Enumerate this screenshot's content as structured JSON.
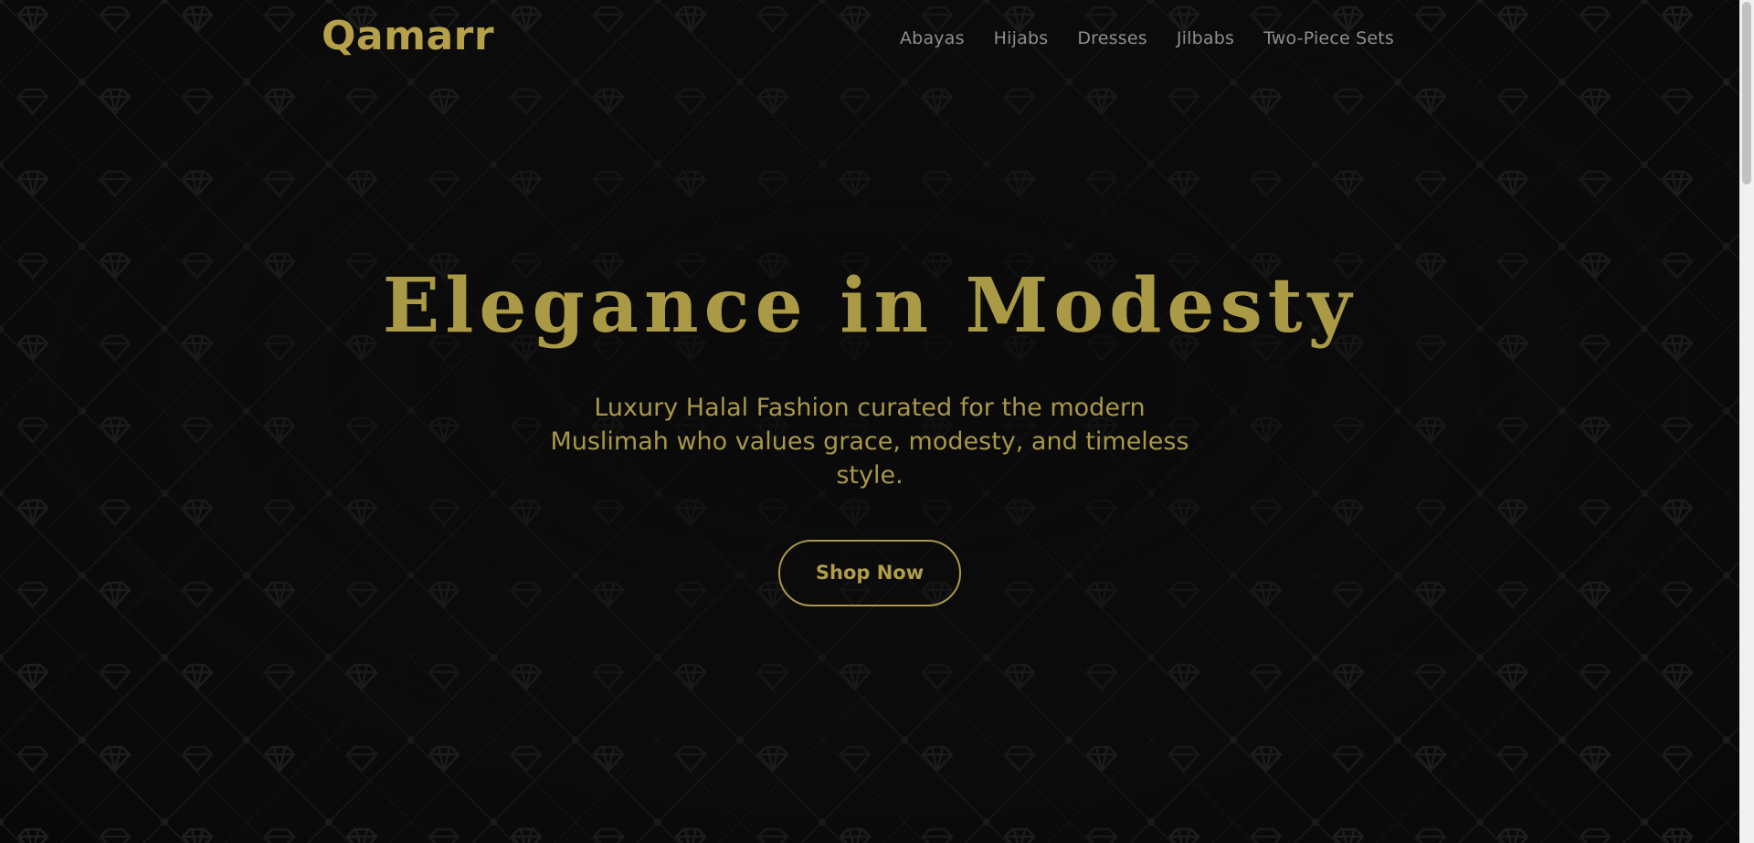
{
  "brand": {
    "logo_text": "Qamarr",
    "accent_color": "#b6a04a",
    "background_color": "#0b0b0b"
  },
  "nav": {
    "items": [
      {
        "label": "Abayas"
      },
      {
        "label": "Hijabs"
      },
      {
        "label": "Dresses"
      },
      {
        "label": "Jilbabs"
      },
      {
        "label": "Two-Piece Sets"
      }
    ]
  },
  "hero": {
    "title": "Elegance in Modesty",
    "subtitle": "Luxury Halal Fashion curated for the modern Muslimah who values grace, modesty, and timeless style.",
    "cta_label": "Shop Now"
  },
  "background": {
    "pattern_icon": "diamond-icon"
  }
}
